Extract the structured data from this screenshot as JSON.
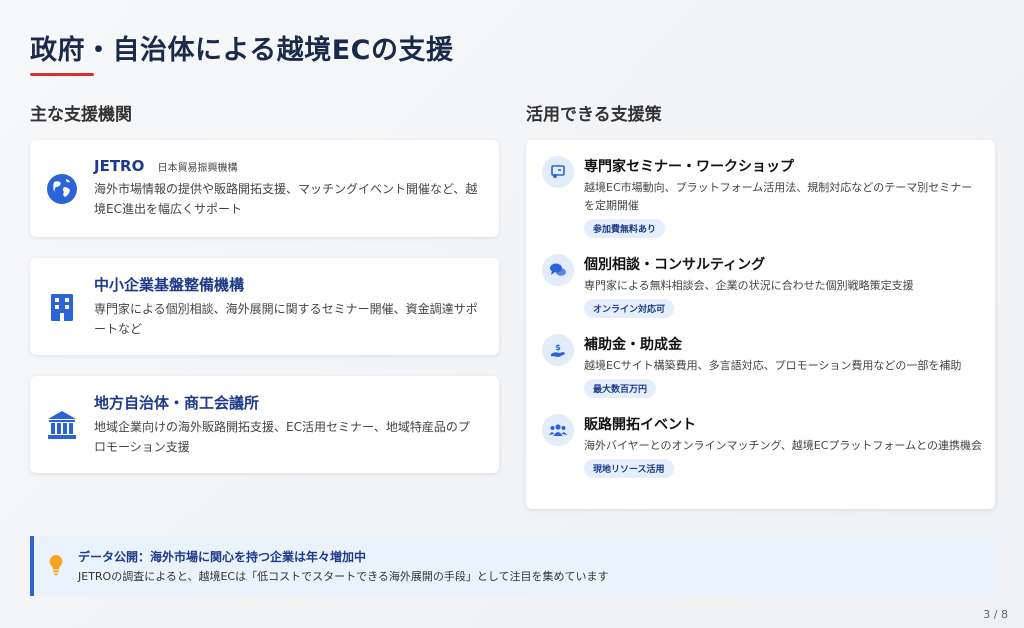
{
  "title": "政府・自治体による越境ECの支援",
  "left_heading": "主な支援機関",
  "right_heading": "活用できる支援策",
  "organizations": [
    {
      "name": "JETRO",
      "sub": "日本貿易振興機構",
      "desc": "海外市場情報の提供や販路開拓支援、マッチングイベント開催など、越境EC進出を幅広くサポート",
      "icon": "globe-icon"
    },
    {
      "name": "中小企業基盤整備機構",
      "sub": "",
      "desc": "専門家による個別相談、海外展開に関するセミナー開催、資金調達サポートなど",
      "icon": "building-icon"
    },
    {
      "name": "地方自治体・商工会議所",
      "sub": "",
      "desc": "地域企業向けの海外販路開拓支援、EC活用セミナー、地域特産品のプロモーション支援",
      "icon": "institution-icon"
    }
  ],
  "policies": [
    {
      "name": "専門家セミナー・ワークショップ",
      "desc": "越境EC市場動向、プラットフォーム活用法、規制対応などのテーマ別セミナーを定期開催",
      "tag": "参加費無料あり",
      "icon": "presentation-icon"
    },
    {
      "name": "個別相談・コンサルティング",
      "desc": "専門家による無料相談会、企業の状況に合わせた個別戦略策定支援",
      "tag": "オンライン対応可",
      "icon": "chat-icon"
    },
    {
      "name": "補助金・助成金",
      "desc": "越境ECサイト構築費用、多言語対応、プロモーション費用などの一部を補助",
      "tag": "最大数百万円",
      "icon": "money-hand-icon"
    },
    {
      "name": "販路開拓イベント",
      "desc": "海外バイヤーとのオンラインマッチング、越境ECプラットフォームとの連携機会",
      "tag": "現地リソース活用",
      "icon": "people-icon"
    }
  ],
  "banner": {
    "title": "データ公開：海外市場に関心を持つ企業は年々増加中",
    "text": "JETROの調査によると、越境ECは「低コストでスタートできる海外展開の手段」として注目を集めています",
    "icon": "lightbulb-icon"
  },
  "page_number": "3 / 8",
  "colors": {
    "accent": "#1e3a8a",
    "underline": "#d9312e",
    "icon_blue": "#2b63d9",
    "bulb": "#f5a623"
  }
}
